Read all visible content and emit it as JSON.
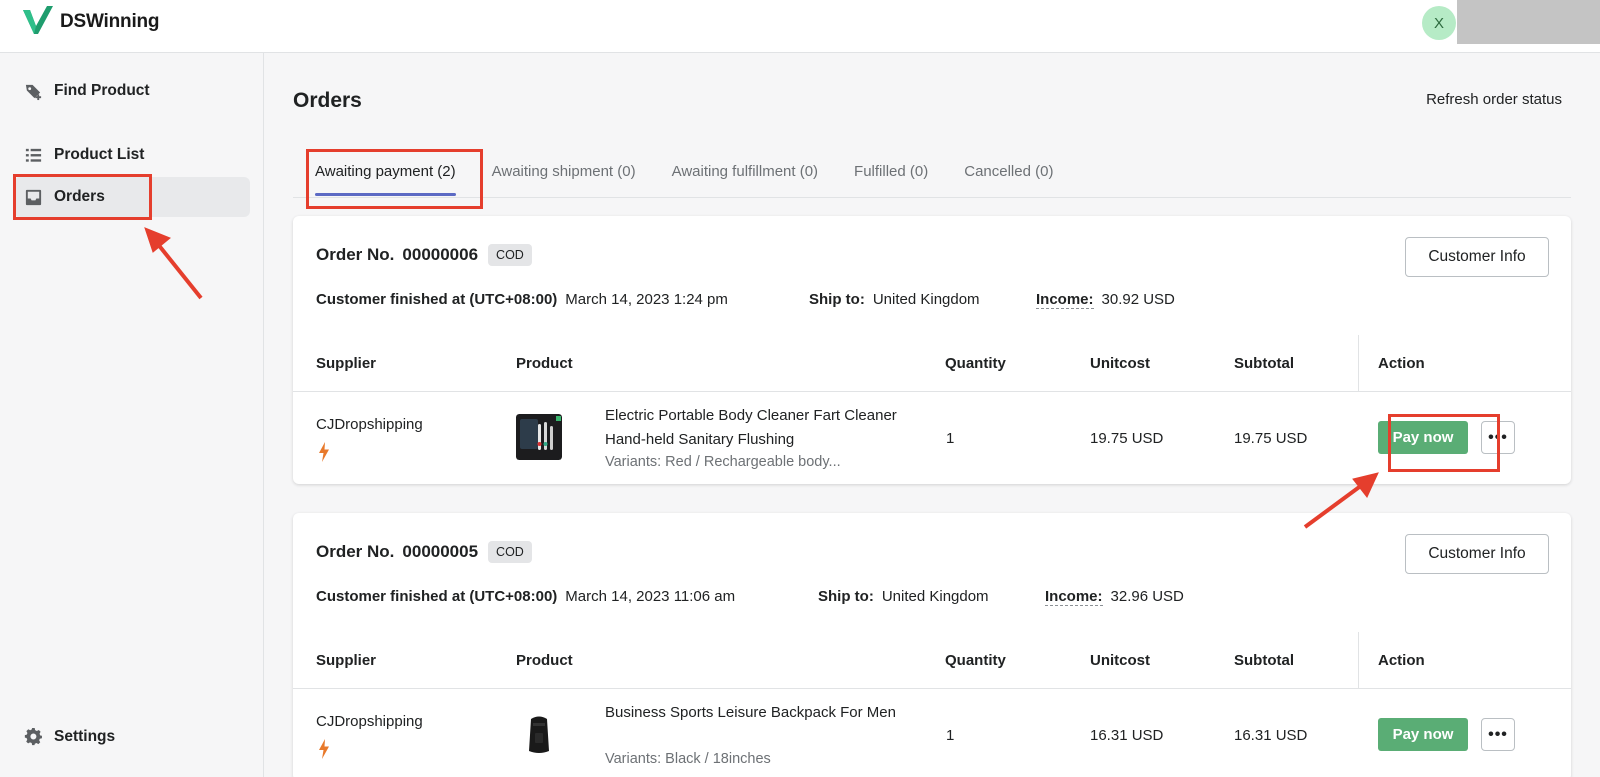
{
  "app": {
    "name": "DSWinning",
    "avatar_initial": "X"
  },
  "sidebar": {
    "items": [
      {
        "label": "Find Product",
        "icon": "tag-plus-icon"
      },
      {
        "label": "Product List",
        "icon": "list-icon"
      },
      {
        "label": "Orders",
        "icon": "inbox-icon",
        "active": true
      },
      {
        "label": "Settings",
        "icon": "gear-icon"
      }
    ]
  },
  "page": {
    "title": "Orders",
    "refresh_label": "Refresh order status"
  },
  "tabs": [
    {
      "label": "Awaiting payment (2)",
      "active": true
    },
    {
      "label": "Awaiting shipment (0)"
    },
    {
      "label": "Awaiting fulfillment (0)"
    },
    {
      "label": "Fulfilled (0)"
    },
    {
      "label": "Cancelled (0)"
    }
  ],
  "labels": {
    "order_no": "Order No.",
    "customer_finished": "Customer finished at (UTC+08:00)",
    "ship_to": "Ship to:",
    "income": "Income:",
    "customer_info": "Customer Info",
    "pay_now": "Pay now",
    "more": "•••"
  },
  "table_headers": [
    "Supplier",
    "Product",
    "Quantity",
    "Unitcost",
    "Subtotal",
    "Action"
  ],
  "orders": [
    {
      "number": "00000006",
      "badge": "COD",
      "finished_at": "March 14, 2023 1:24 pm",
      "ship_to": "United Kingdom",
      "income": "30.92 USD",
      "item": {
        "supplier": "CJDropshipping",
        "title": "Electric Portable Body Cleaner Fart Cleaner Hand-held Sanitary Flushing",
        "variant": "Variants: Red / Rechargeable body...",
        "quantity": "1",
        "unitcost": "19.75 USD",
        "subtotal": "19.75 USD"
      }
    },
    {
      "number": "00000005",
      "badge": "COD",
      "finished_at": "March 14, 2023 11:06 am",
      "ship_to": "United Kingdom",
      "income": "32.96 USD",
      "item": {
        "supplier": "CJDropshipping",
        "title": "Business Sports Leisure Backpack For Men",
        "variant": "Variants: Black / 18inches",
        "quantity": "1",
        "unitcost": "16.31 USD",
        "subtotal": "16.31 USD"
      }
    }
  ],
  "colors": {
    "accent_tab": "#5c6ac4",
    "pay_button": "#5aad75",
    "annotation": "#e53e2d",
    "bolt": "#e8792b"
  }
}
